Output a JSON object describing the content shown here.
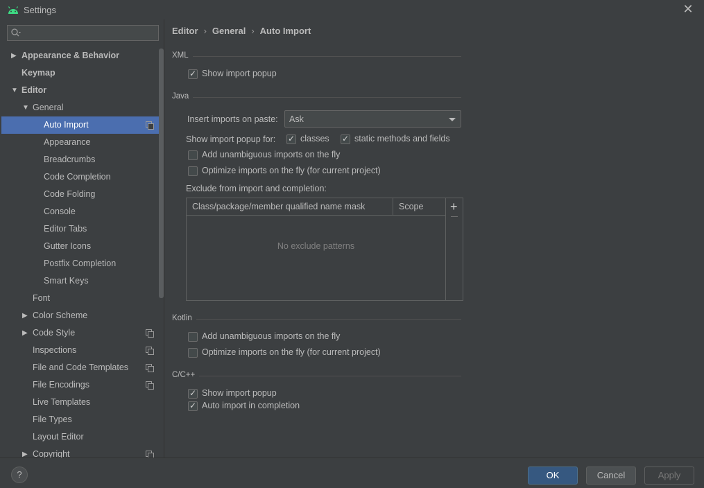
{
  "window": {
    "title": "Settings"
  },
  "sidebar": {
    "search_placeholder": "",
    "items": [
      {
        "label": "Appearance & Behavior"
      },
      {
        "label": "Keymap"
      },
      {
        "label": "Editor"
      },
      {
        "label": "General"
      },
      {
        "label": "Auto Import"
      },
      {
        "label": "Appearance"
      },
      {
        "label": "Breadcrumbs"
      },
      {
        "label": "Code Completion"
      },
      {
        "label": "Code Folding"
      },
      {
        "label": "Console"
      },
      {
        "label": "Editor Tabs"
      },
      {
        "label": "Gutter Icons"
      },
      {
        "label": "Postfix Completion"
      },
      {
        "label": "Smart Keys"
      },
      {
        "label": "Font"
      },
      {
        "label": "Color Scheme"
      },
      {
        "label": "Code Style"
      },
      {
        "label": "Inspections"
      },
      {
        "label": "File and Code Templates"
      },
      {
        "label": "File Encodings"
      },
      {
        "label": "Live Templates"
      },
      {
        "label": "File Types"
      },
      {
        "label": "Layout Editor"
      },
      {
        "label": "Copyright"
      }
    ]
  },
  "breadcrumb": {
    "parts": [
      "Editor",
      "General",
      "Auto Import"
    ]
  },
  "xml": {
    "title": "XML",
    "show_import_popup": {
      "label": "Show import popup",
      "checked": true
    }
  },
  "java": {
    "title": "Java",
    "insert_imports_label": "Insert imports on paste:",
    "insert_imports_value": "Ask",
    "show_popup_for_label": "Show import popup for:",
    "classes": {
      "label": "classes",
      "checked": true
    },
    "static_methods": {
      "label": "static methods and fields",
      "checked": true
    },
    "add_unambiguous": {
      "label": "Add unambiguous imports on the fly",
      "checked": false
    },
    "optimize": {
      "label": "Optimize imports on the fly (for current project)",
      "checked": false
    },
    "exclude_label": "Exclude from import and completion:",
    "table": {
      "col1": "Class/package/member qualified name mask",
      "col2": "Scope",
      "empty_text": "No exclude patterns",
      "add": "+"
    }
  },
  "kotlin": {
    "title": "Kotlin",
    "add_unambiguous": {
      "label": "Add unambiguous imports on the fly",
      "checked": false
    },
    "optimize": {
      "label": "Optimize imports on the fly (for current project)",
      "checked": false
    }
  },
  "cpp": {
    "title": "C/C++",
    "show_import_popup": {
      "label": "Show import popup",
      "checked": true
    },
    "auto_import": {
      "label": "Auto import in completion",
      "checked": true
    }
  },
  "footer": {
    "help": "?",
    "ok": "OK",
    "cancel": "Cancel",
    "apply": "Apply"
  },
  "colors": {
    "background": "#3c3f41",
    "selection": "#4b6eaf",
    "ok_button": "#365880"
  }
}
